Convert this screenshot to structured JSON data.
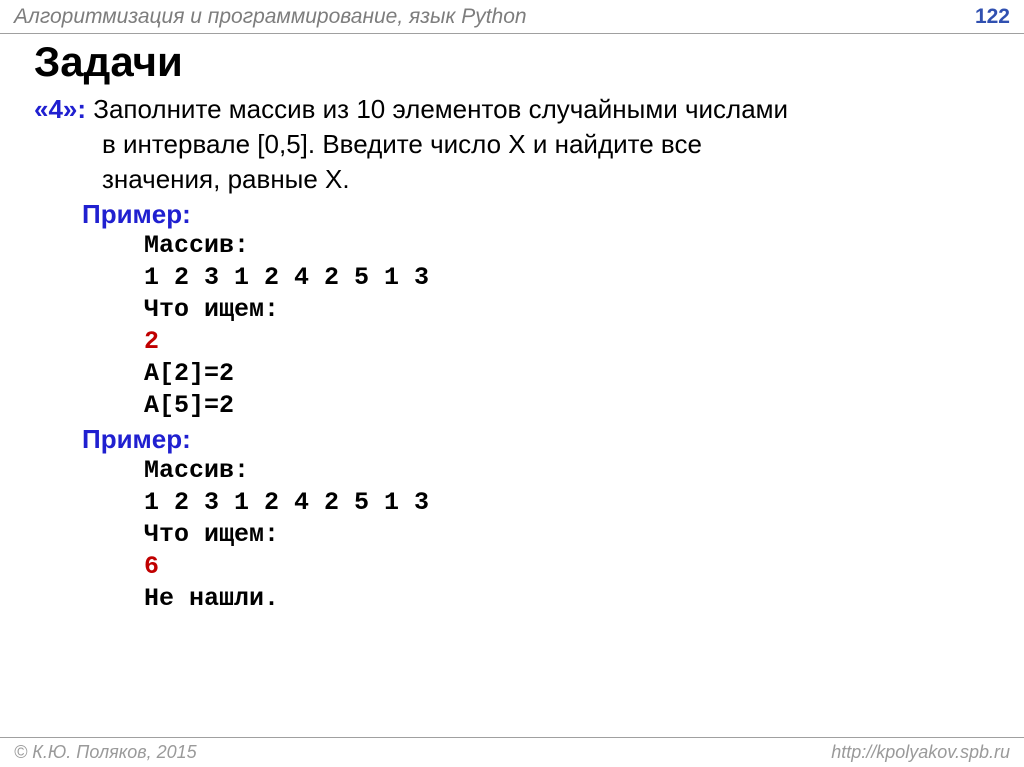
{
  "header": {
    "title": "Алгоритмизация и программирование, язык Python",
    "page": "122"
  },
  "title": "Задачи",
  "task": {
    "marker": "«4»:",
    "line1_rest": " Заполните массив из 10 элементов случайными числами",
    "line2": "в интервале [0,5]. Введите число X и найдите все",
    "line3": "значения, равные X."
  },
  "example1": {
    "label": "Пример:",
    "l1": "Массив:",
    "l2": "1 2 3 1 2 4 2 5 1 3",
    "l3": "Что ищем:",
    "l4": "2",
    "l5": "A[2]=2",
    "l6": "A[5]=2"
  },
  "example2": {
    "label": "Пример:",
    "l1": "Массив:",
    "l2": "1 2 3 1 2 4 2 5 1 3",
    "l3": "Что ищем:",
    "l4": "6",
    "l5": "Не нашли."
  },
  "footer": {
    "left": "© К.Ю. Поляков, 2015",
    "right": "http://kpolyakov.spb.ru"
  }
}
